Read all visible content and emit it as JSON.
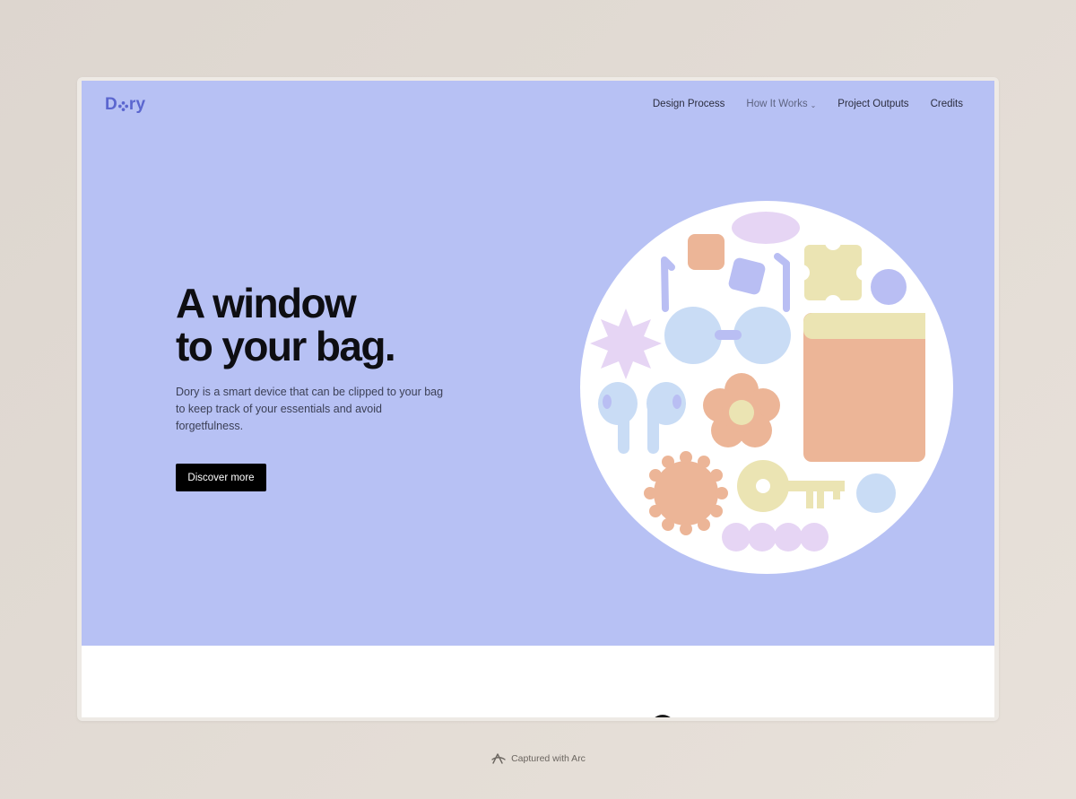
{
  "brand": {
    "logo_text_start": "D",
    "logo_text_end": "ry",
    "logo_icon": "flower-dot-icon",
    "color": "#5b66cf"
  },
  "nav": {
    "items": [
      {
        "label": "Design Process"
      },
      {
        "label": "How It Works",
        "has_dropdown": true
      },
      {
        "label": "Project Outputs"
      },
      {
        "label": "Credits"
      }
    ]
  },
  "hero": {
    "headline_line1": "A window",
    "headline_line2": "to your bag.",
    "description": "Dory is a smart device that can be clipped to your bag to keep track of your essentials and avoid forgetfulness.",
    "cta_label": "Discover more",
    "background": "#b7c1f4",
    "illustration_icons": [
      "oval-icon",
      "square-icon",
      "rounded-square-icon",
      "glasses-icon",
      "clover-icon",
      "circle-icon",
      "star-icon",
      "card-wallet-icon",
      "earbuds-icon",
      "flower-icon",
      "cookie-icon",
      "key-icon",
      "bead-strip-icon"
    ]
  },
  "footer_caption": {
    "text": "Captured with Arc",
    "icon": "arc-logo-icon"
  },
  "colors": {
    "peach": "#ecb597",
    "lavender": "#e6d5f4",
    "periwinkle": "#b9bef3",
    "sky": "#c9dcf5",
    "butter": "#ebe4b3",
    "cta": "#000000"
  }
}
